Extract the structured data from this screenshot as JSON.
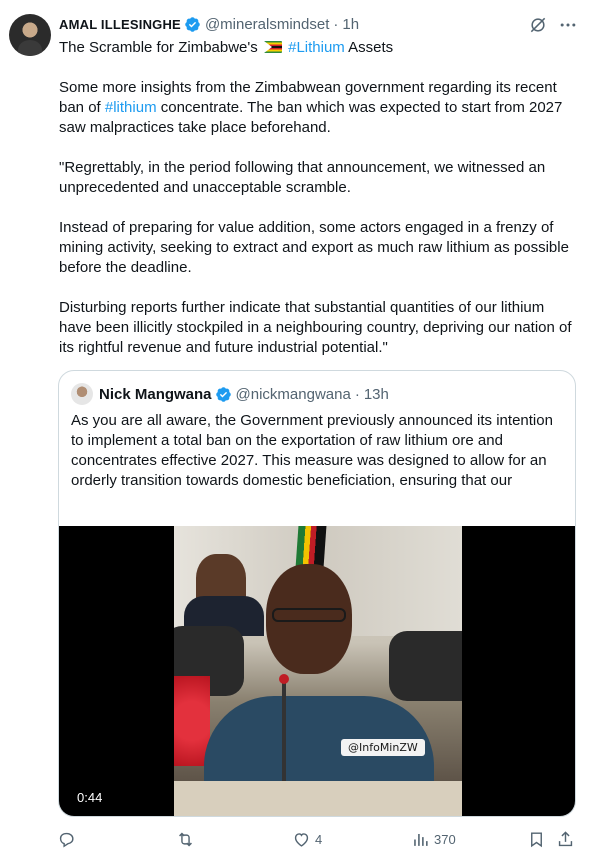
{
  "tweet": {
    "author_name": "AMAL ILLESINGHE",
    "handle": "@mineralsmindset",
    "separator": "·",
    "time": "1h",
    "title_prefix": "The Scramble for Zimbabwe's",
    "title_hashtag": "#Lithium",
    "title_suffix": " Assets",
    "p1_a": "Some more insights from the Zimbabwean government regarding its recent ban of ",
    "p1_hashtag": "#lithium",
    "p1_b": " concentrate. The ban which was expected to start from 2027 saw malpractices take place beforehand.",
    "p2": "\"Regrettably, in the period following that announcement, we witnessed an unprecedented and unacceptable scramble.",
    "p3": "Instead of preparing for value addition, some actors engaged in a frenzy of mining activity, seeking to extract and export as much raw lithium as possible before the deadline.",
    "p4": "Disturbing reports further indicate that substantial quantities of our lithium have been illicitly stockpiled in a neighbouring country, depriving our nation of its rightful revenue and future industrial potential.\""
  },
  "quote": {
    "author_name": "Nick Mangwana",
    "handle": "@nickmangwana",
    "separator": "·",
    "time": "13h",
    "text": "As you are all aware, the Government previously announced its intention to implement a total ban on the exportation of raw lithium ore and concentrates effective 2027. This measure was designed to allow for an orderly transition towards domestic beneficiation, ensuring that our",
    "video": {
      "watermark": "@InfoMinZW",
      "duration": "0:44"
    }
  },
  "actions": {
    "reply_count": "",
    "retweet_count": "",
    "like_count": "4",
    "views_count": "370"
  },
  "colors": {
    "link": "#1d9bf0",
    "verified": "#1d9bf0",
    "muted": "#536471",
    "border": "#cfd9de"
  },
  "icons": [
    "verified-badge-icon",
    "grok-icon",
    "more-icon",
    "reply-icon",
    "retweet-icon",
    "like-icon",
    "views-icon",
    "bookmark-icon",
    "share-icon",
    "flag-zimbabwe-icon"
  ]
}
